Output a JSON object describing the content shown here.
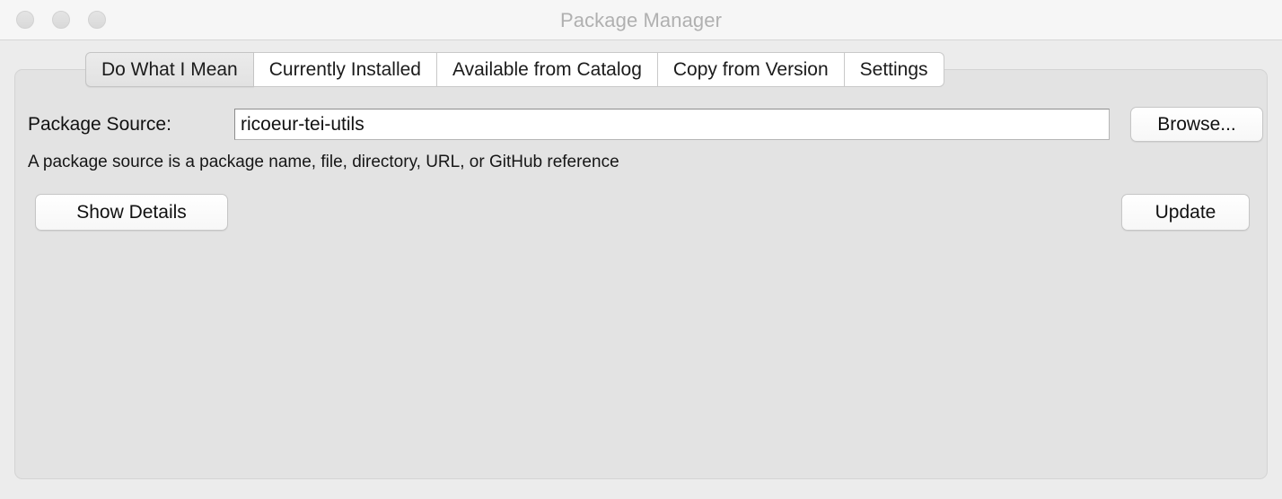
{
  "window": {
    "title": "Package Manager",
    "traffic_lights": [
      "close",
      "minimize",
      "maximize"
    ]
  },
  "tabs": [
    {
      "label": "Do What I Mean",
      "selected": true
    },
    {
      "label": "Currently Installed",
      "selected": false
    },
    {
      "label": "Available from Catalog",
      "selected": false
    },
    {
      "label": "Copy from Version",
      "selected": false
    },
    {
      "label": "Settings",
      "selected": false
    }
  ],
  "form": {
    "source_label": "Package Source:",
    "source_value": "ricoeur-tei-utils",
    "source_placeholder": "",
    "browse_label": "Browse...",
    "hint": "A package source is a package name, file, directory, URL, or GitHub reference"
  },
  "actions": {
    "show_details_label": "Show Details",
    "update_label": "Update"
  },
  "colors": {
    "window_background": "#ececec",
    "titlebar_background": "#f6f6f6",
    "panel_background": "#e3e3e3",
    "title_text": "#b0b0b0",
    "body_text": "#111111",
    "tab_selected_background": "#e6e6e6",
    "tab_background": "#ffffff"
  }
}
